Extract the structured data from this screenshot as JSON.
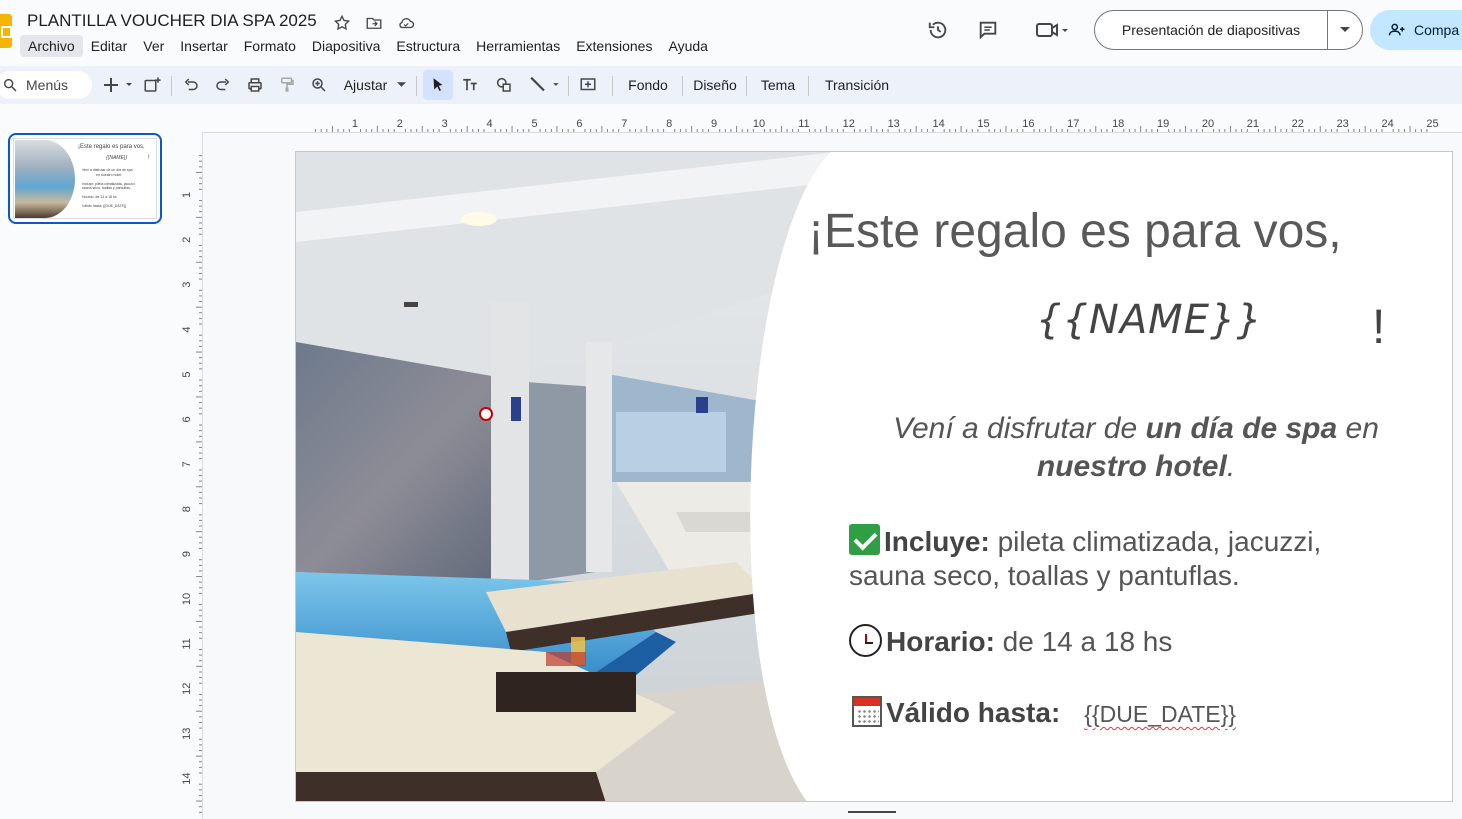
{
  "header": {
    "doc_title": "PLANTILLA VOUCHER DIA SPA 2025",
    "menu": [
      "Archivo",
      "Editar",
      "Ver",
      "Insertar",
      "Formato",
      "Diapositiva",
      "Estructura",
      "Herramientas",
      "Extensiones",
      "Ayuda"
    ],
    "present_label": "Presentación de diapositivas",
    "share_label": "Compa"
  },
  "toolbar": {
    "search_label": "Menús",
    "zoom_label": "Ajustar",
    "fondo": "Fondo",
    "diseno": "Diseño",
    "tema": "Tema",
    "transicion": "Transición"
  },
  "thumbnail": {
    "line1": "¡Este regalo es para vos,",
    "line2": "{{NAME}}",
    "line2b": "!",
    "line3": "Vení a disfrutar de un día de spa",
    "line3b": "en nuestro hotel.",
    "line4": "Incluye: pileta climatizada, jacuzzi,",
    "line4b": "sauna seco, toallas y pantuflas.",
    "line5": "Horario: de 14 a 18 hs",
    "line6": "Válido hasta: {{DUE_DATE}}"
  },
  "ruler": {
    "h": [
      "1",
      "2",
      "3",
      "4",
      "5",
      "6",
      "7",
      "8",
      "9",
      "10",
      "11",
      "12",
      "13",
      "14",
      "15",
      "16",
      "17",
      "18",
      "19",
      "20",
      "21",
      "22",
      "23",
      "24",
      "25"
    ],
    "v": [
      "1",
      "2",
      "3",
      "4",
      "5",
      "6",
      "7",
      "8",
      "9",
      "10",
      "11",
      "12",
      "13",
      "14"
    ]
  },
  "slide": {
    "headline": "¡Este regalo es para vos,",
    "name_placeholder": "{{NAME}}",
    "exclaim": "!",
    "invite_pre": "Vení a disfrutar de ",
    "invite_bold": "un día de spa",
    "invite_mid": " en ",
    "invite_bold2": "nuestro hotel",
    "invite_end": ".",
    "incluye_label": "Incluye:",
    "incluye_text": " pileta climatizada, jacuzzi, sauna seco, toallas y pantuflas.",
    "horario_label": "Horario:",
    "horario_text": " de 14 a 18 hs",
    "valido_label": "Válido hasta:",
    "due_placeholder": "{{DUE_DATE}}"
  },
  "colors": {
    "accent": "#0b57d0",
    "share_bg": "#c2e7ff",
    "toolbar_bg": "#edf2fa"
  }
}
